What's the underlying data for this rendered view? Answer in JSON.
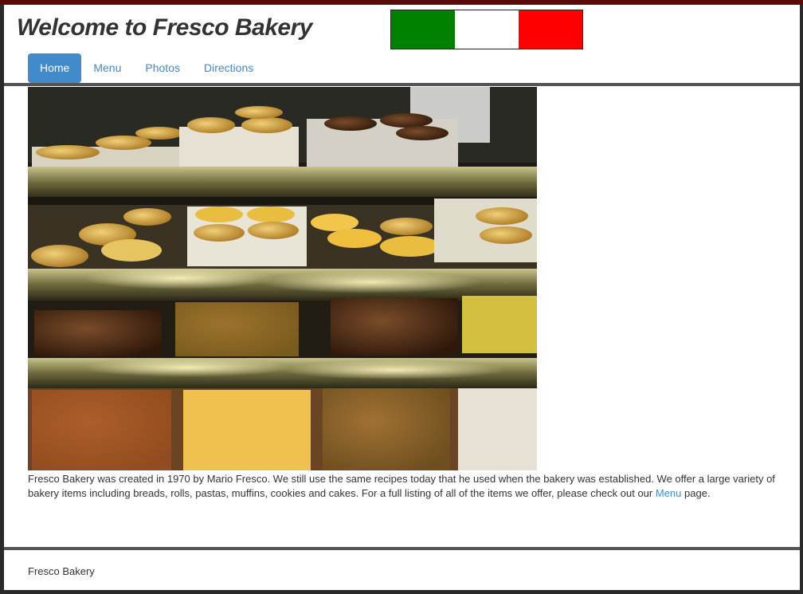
{
  "header": {
    "title": "Welcome to Fresco Bakery",
    "flag_colors": [
      "#008000",
      "#ffffff",
      "#ff0000"
    ]
  },
  "nav": {
    "items": [
      {
        "label": "Home",
        "active": true
      },
      {
        "label": "Menu",
        "active": false
      },
      {
        "label": "Photos",
        "active": false
      },
      {
        "label": "Directions",
        "active": false
      }
    ]
  },
  "intro": {
    "text_before_link": "Fresco Bakery was created in 1970 by Mario Fresco. We still use the same recipes today that he used when the bakery was established. We offer a large variety of bakery items including breads, rolls, pastas, muffins, cookies and cakes. For a full listing of all of the items we offer, please check out our ",
    "link_label": "Menu",
    "text_after_link": " page."
  },
  "footer": {
    "text": "Fresco Bakery"
  },
  "colors": {
    "accent": "#428bca",
    "divider": "#555555",
    "top_bar": "#5a0a0a"
  }
}
